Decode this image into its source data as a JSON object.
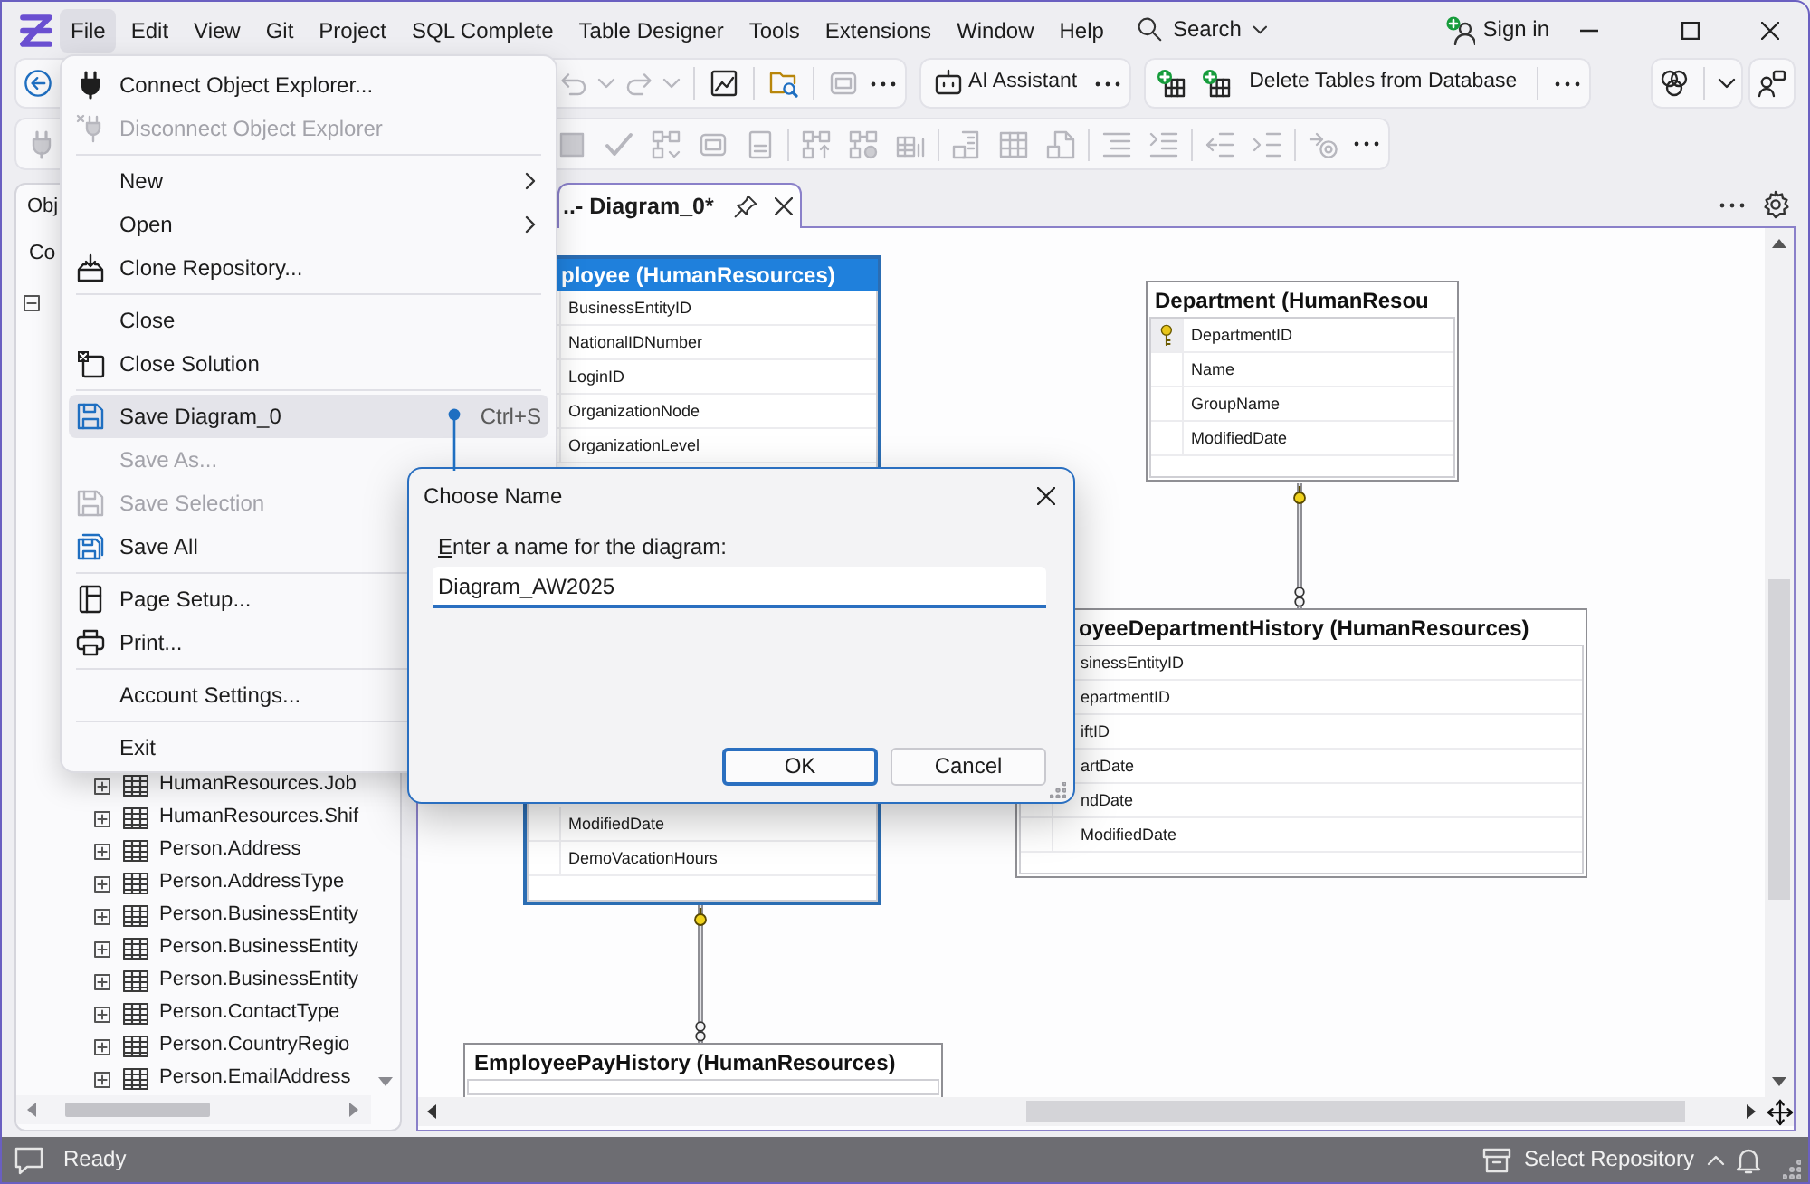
{
  "menu_bar": {
    "items": [
      {
        "label": "File",
        "selected": true
      },
      {
        "label": "Edit",
        "selected": false
      },
      {
        "label": "View",
        "selected": false
      },
      {
        "label": "Git",
        "selected": false
      },
      {
        "label": "Project",
        "selected": false
      },
      {
        "label": "SQL Complete",
        "selected": false
      },
      {
        "label": "Table Designer",
        "selected": false
      },
      {
        "label": "Tools",
        "selected": false
      },
      {
        "label": "Extensions",
        "selected": false
      },
      {
        "label": "Window",
        "selected": false
      },
      {
        "label": "Help",
        "selected": false
      }
    ],
    "search": {
      "label": "Search"
    },
    "sign_in": {
      "label": "Sign in"
    }
  },
  "toolbar_1": {
    "groups": [
      {
        "buttons": [
          {
            "disabled": false
          },
          {
            "disabled": true
          },
          {
            "disabled": true
          },
          {
            "disabled": true
          },
          {
            "disabled": true
          },
          {
            "disabled": false
          },
          {
            "disabled": false
          },
          {
            "disabled": true
          },
          {
            "disabled": false
          }
        ]
      },
      {
        "buttons": [
          {
            "label": "AI Assistant",
            "disabled": false
          },
          {
            "disabled": false
          }
        ]
      },
      {
        "buttons": [
          {
            "disabled": false
          },
          {
            "disabled": false
          },
          {
            "label": "Delete Tables from Database",
            "disabled": false
          },
          {
            "disabled": false
          }
        ]
      },
      {
        "buttons": [
          {
            "disabled": false
          },
          {
            "disabled": false
          }
        ]
      },
      {
        "buttons": [
          {
            "disabled": false
          }
        ]
      }
    ]
  },
  "toolbar_2": {
    "groups": [
      {
        "buttons": [
          {
            "disabled": true
          },
          {
            "disabled": true
          },
          {
            "disabled": true
          },
          {
            "disabled": true
          },
          {
            "disabled": true
          },
          {
            "disabled": true
          },
          {
            "disabled": true
          },
          {
            "disabled": true
          },
          {
            "disabled": true
          },
          {
            "disabled": true
          },
          {
            "disabled": true
          },
          {
            "disabled": true
          },
          {
            "disabled": true
          },
          {
            "disabled": true
          },
          {
            "disabled": true
          },
          {
            "disabled": true
          },
          {
            "disabled": true
          },
          {
            "disabled": false
          }
        ]
      }
    ]
  },
  "object_explorer": {
    "tab": "Obj",
    "connection": "Co",
    "tree": [
      {
        "expanded": true,
        "children": [
          {
            "label": "HumanResources.Job",
            "expanded": false
          },
          {
            "label": "HumanResources.Shif",
            "expanded": false
          },
          {
            "label": "Person.Address",
            "expanded": false
          },
          {
            "label": "Person.AddressType",
            "expanded": false
          },
          {
            "label": "Person.BusinessEntity",
            "expanded": false
          },
          {
            "label": "Person.BusinessEntity",
            "expanded": false
          },
          {
            "label": "Person.BusinessEntity",
            "expanded": false
          },
          {
            "label": "Person.ContactType",
            "expanded": false
          },
          {
            "label": "Person.CountryRegio",
            "expanded": false
          },
          {
            "label": "Person.EmailAddress",
            "expanded": false
          }
        ]
      }
    ]
  },
  "document": {
    "tab": {
      "title": "..- Diagram_0*",
      "selected": true
    },
    "diagram": {
      "tables": [
        {
          "title": "ployee (HumanResources)",
          "selected": true,
          "rows": [
            {
              "name": "BusinessEntityID"
            },
            {
              "name": "NationalIDNumber"
            },
            {
              "name": "LoginID"
            },
            {
              "name": "OrganizationNode"
            },
            {
              "name": "OrganizationLevel"
            }
          ],
          "lower_rows": [
            {
              "name": "ModifiedDate",
              "key": false
            },
            {
              "name": "DemoVacationHours",
              "key": false
            }
          ]
        },
        {
          "title": "Department (HumanResou",
          "selected": false,
          "rows": [
            {
              "name": "DepartmentID",
              "key": true
            },
            {
              "name": "Name",
              "key": false
            },
            {
              "name": "GroupName",
              "key": false
            },
            {
              "name": "ModifiedDate",
              "key": false
            }
          ]
        },
        {
          "title": "oyeeDepartmentHistory (HumanResources)",
          "selected": false,
          "rows": [
            {
              "name": "sinessEntityID"
            },
            {
              "name": "epartmentID"
            },
            {
              "name": "iftID"
            },
            {
              "name": "artDate"
            },
            {
              "name": "ndDate"
            },
            {
              "name": "ModifiedDate",
              "key": false
            }
          ]
        },
        {
          "title": "EmployeePayHistory (HumanResources)",
          "selected": false
        }
      ]
    }
  },
  "file_menu": {
    "groups": [
      [
        {
          "label": "Connect Object Explorer...",
          "disabled": false,
          "selected": false
        },
        {
          "label": "Disconnect Object Explorer",
          "disabled": true,
          "selected": false
        }
      ],
      [
        {
          "label": "New",
          "submenu": true,
          "disabled": false,
          "selected": false
        },
        {
          "label": "Open",
          "submenu": true,
          "disabled": false,
          "selected": false
        },
        {
          "label": "Clone Repository...",
          "disabled": false,
          "selected": false
        }
      ],
      [
        {
          "label": "Close",
          "disabled": false,
          "selected": false
        },
        {
          "label": "Close Solution",
          "disabled": false,
          "selected": false
        }
      ],
      [
        {
          "label": "Save Diagram_0",
          "shortcut": "Ctrl+S",
          "disabled": false,
          "selected": true
        },
        {
          "label": "Save As...",
          "disabled": true,
          "selected": false
        },
        {
          "label": "Save Selection",
          "disabled": true,
          "selected": false
        },
        {
          "label": "Save All",
          "disabled": false,
          "selected": false
        }
      ],
      [
        {
          "label": "Page Setup...",
          "disabled": false,
          "selected": false
        },
        {
          "label": "Print...",
          "disabled": false,
          "selected": false
        }
      ],
      [
        {
          "label": "Account Settings...",
          "disabled": false,
          "selected": false
        }
      ],
      [
        {
          "label": "Exit",
          "disabled": false,
          "selected": false
        }
      ]
    ]
  },
  "dialog": {
    "title": "Choose Name",
    "label": "Enter a name for the diagram:",
    "value": "Diagram_AW2025",
    "buttons": [
      {
        "label": "OK",
        "default": true
      },
      {
        "label": "Cancel",
        "default": false
      }
    ]
  },
  "status_bar": {
    "text": "Ready",
    "repository": "Select Repository"
  }
}
